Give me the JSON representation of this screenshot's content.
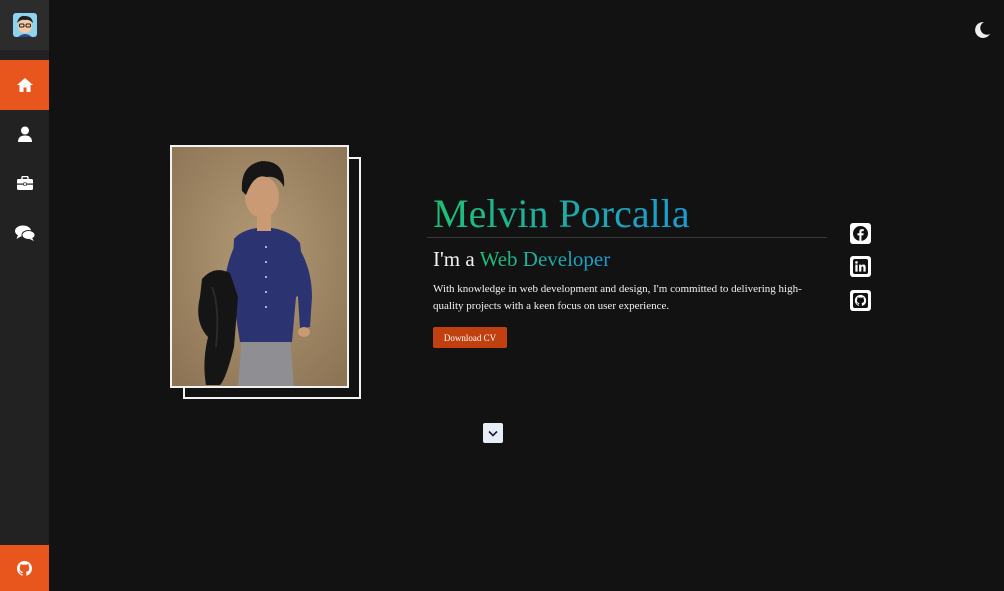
{
  "sidebar": {
    "avatar_icon": "avatar-icon",
    "items": [
      {
        "icon": "home-icon",
        "active": true
      },
      {
        "icon": "user-icon",
        "active": false
      },
      {
        "icon": "briefcase-icon",
        "active": false
      },
      {
        "icon": "chat-icon",
        "active": false
      }
    ],
    "footer_icon": "github-icon"
  },
  "theme_toggle": {
    "icon": "moon-icon"
  },
  "hero": {
    "name": "Melvin Porcalla",
    "role_prefix": "I'm a ",
    "role": "Web Developer",
    "description": "With knowledge in web development and design, I'm committed to delivering high-quality projects with a keen focus on user experience.",
    "download_label": "Download CV"
  },
  "social": [
    {
      "icon": "facebook-icon"
    },
    {
      "icon": "linkedin-icon"
    },
    {
      "icon": "github-icon"
    }
  ],
  "scroll_icon": "chevron-down-icon",
  "colors": {
    "accent": "#e8561d",
    "button": "#c2400f",
    "background": "#121212",
    "sidebar": "#222222",
    "gradient_start": "#1fbf75",
    "gradient_end": "#1d9ad6"
  }
}
